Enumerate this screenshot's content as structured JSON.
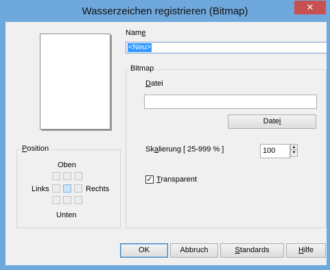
{
  "window": {
    "title": "Wasserzeichen registrieren (Bitmap)",
    "close_glyph": "✕"
  },
  "name_field": {
    "label_pre": "Nam",
    "label_accel": "e",
    "value": "<Neu>"
  },
  "bitmap_group": {
    "legend": "Bitmap",
    "datei_label_accel": "D",
    "datei_label_rest": "atei",
    "file_path": "",
    "browse_button_pre": "Date",
    "browse_button_accel": "i"
  },
  "scaling": {
    "label_pre": "Sk",
    "label_accel": "a",
    "label_rest": "lierung [ 25-999 % ]",
    "value": "100",
    "up_glyph": "▲",
    "down_glyph": "▼"
  },
  "transparent": {
    "checked": true,
    "check_glyph": "✓",
    "label_accel": "T",
    "label_rest": "ransparent"
  },
  "position_group": {
    "legend_accel": "P",
    "legend_rest": "osition",
    "top_label": "Oben",
    "left_label": "Links",
    "right_label": "Rechts",
    "bottom_label": "Unten",
    "selected": "center"
  },
  "buttons": {
    "ok": "OK",
    "cancel": "Abbruch",
    "defaults_accel": "S",
    "defaults_rest": "tandards",
    "help_accel": "H",
    "help_rest": "ilfe"
  }
}
